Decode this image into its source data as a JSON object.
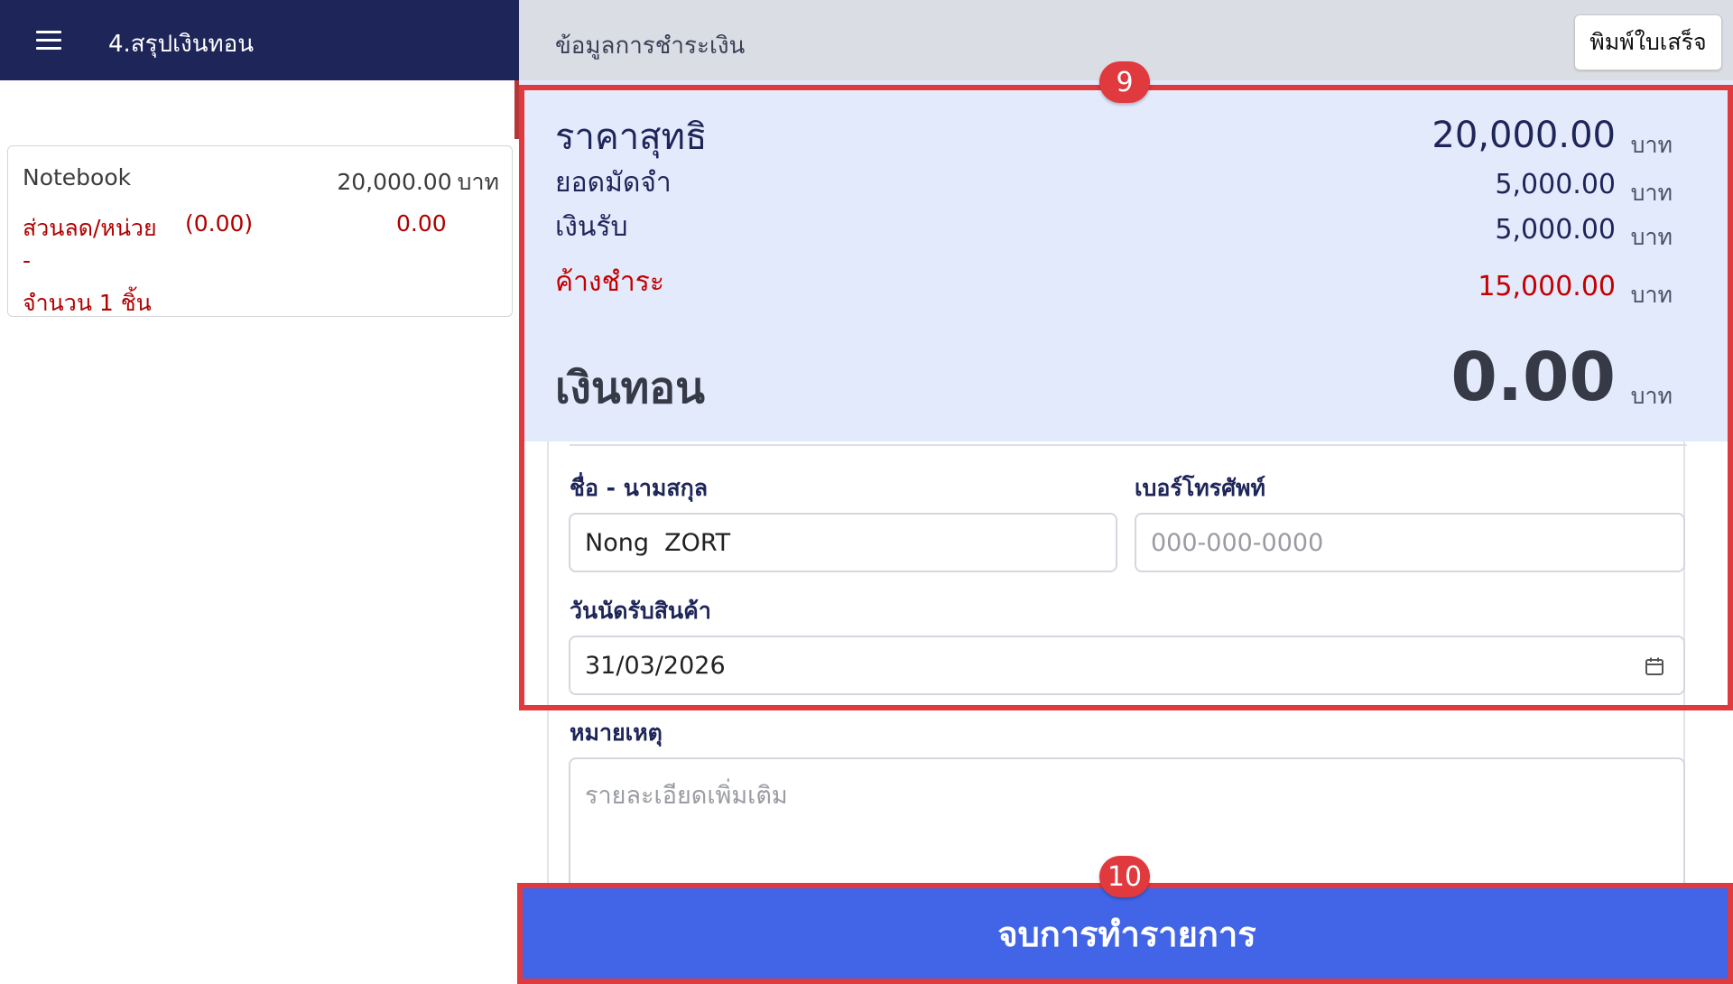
{
  "left_header": {
    "title": "4.สรุปเงินทอน",
    "menu_icon": "hamburger-menu-icon"
  },
  "order_item": {
    "name": "Notebook",
    "price": "20,000.00",
    "price_unit": "บาท",
    "discount_label": "ส่วนลด/หน่วย",
    "discount_percent": "(0.00)",
    "discount_value": "0.00",
    "dash": "-",
    "quantity": "จำนวน 1 ชิ้น"
  },
  "right_header": {
    "title": "ข้อมูลการชำระเงิน",
    "print_button": "พิมพ์ใบเสร็จ"
  },
  "summary": {
    "net_price_label": "ราคาสุทธิ",
    "net_price_value": "20,000.00",
    "deposit_label": "ยอดมัดจำ",
    "deposit_value": "5,000.00",
    "received_label": "เงินรับ",
    "received_value": "5,000.00",
    "outstanding_label": "ค้างชำระ",
    "outstanding_value": "15,000.00",
    "change_label": "เงินทอน",
    "change_value": "0.00",
    "unit": "บาท"
  },
  "form": {
    "name_label": "ชื่อ - นามสกุล",
    "name_value": "Nong  ZORT",
    "phone_label": "เบอร์โทรศัพท์",
    "phone_placeholder": "000-000-0000",
    "pickup_date_label": "วันนัดรับสินค้า",
    "pickup_date_value": "31/03/2026",
    "note_label": "หมายเหตุ",
    "note_placeholder": "รายละเอียดเพิ่มเติม"
  },
  "finish_button": "จบการทำรายการ",
  "annotations": {
    "badge_9": "9",
    "badge_10": "10"
  },
  "colors": {
    "header_dark": "#1e2559",
    "summary_bg": "#e3eafc",
    "accent_red": "#c40000",
    "highlight": "#e0393e",
    "primary_button": "#4265e8"
  }
}
